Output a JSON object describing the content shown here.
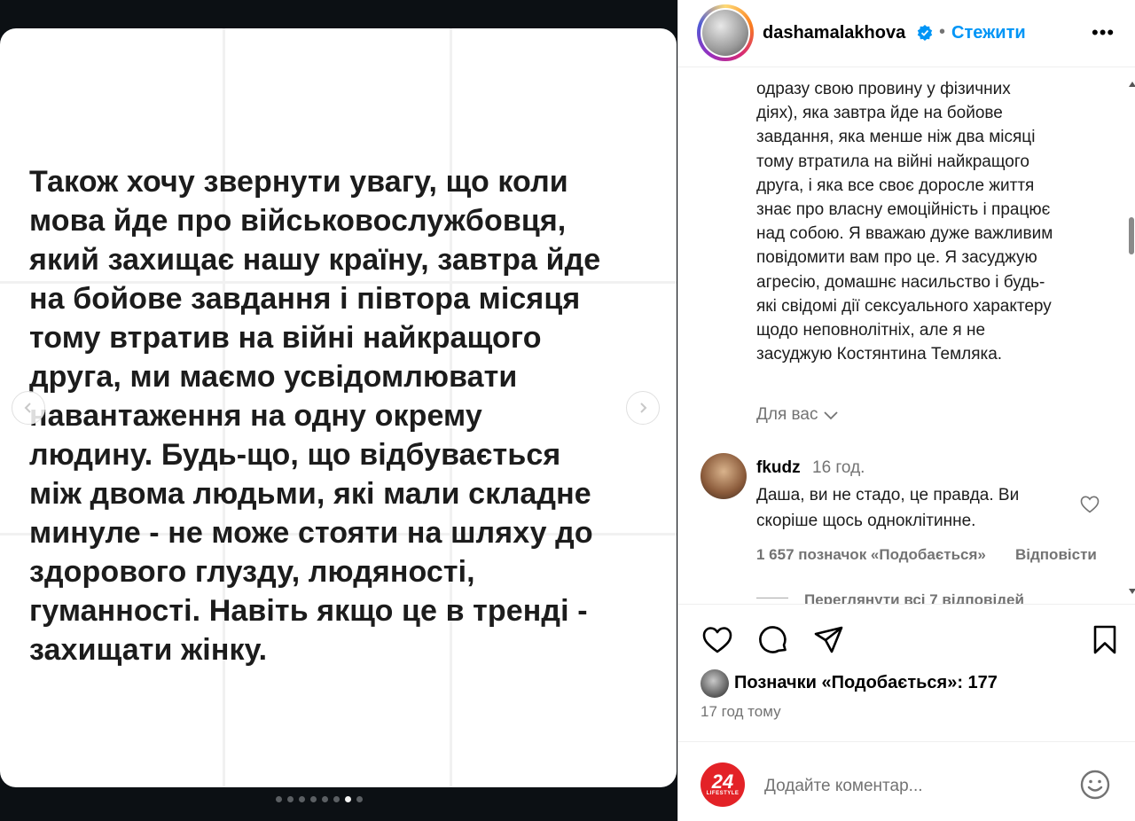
{
  "post": {
    "slide_lines": [
      "Також хочу звернути увагу, що коли",
      "мова йде про військовослужбовця,",
      "який захищає нашу країну, завтра йде",
      "на бойове завдання і півтора місяця",
      "тому втратив на війні найкращого",
      "друга, ми маємо усвідомлювати",
      "навантаження на одну окрему",
      "людину. Будь-що, що відбувається",
      "між двома людьми, які мали складне",
      "минуле - не може стояти на шляху до",
      "здорового глузду, людяності,",
      "гуманності. Навіть якщо це в тренді -",
      "захищати жінку."
    ],
    "carousel_total": 8,
    "carousel_active_index": 6
  },
  "header": {
    "username": "dashamalakhova",
    "separator": "•",
    "follow_label": "Стежити",
    "more_label": "•••"
  },
  "caption": {
    "lines": [
      "одразу свою провину у фізичних",
      "діях), яка завтра йде на бойове",
      "завдання, яка менше ніж два місяці",
      "тому втратила на війні найкращого",
      "друга, і яка все своє доросле життя",
      "знає про власну емоційність і працює",
      "над собою. Я вважаю дуже важливим",
      "повідомити вам про це. Я засуджую",
      "агресію, домашнє насильство і будь-",
      "які свідомі дії сексуального характеру",
      "щодо неповнолітніх, але я не",
      "засуджую Костянтина Темляка."
    ]
  },
  "for_you_label": "Для вас",
  "comment": {
    "username": "fkudz",
    "time": "16 год.",
    "text_lines": [
      "Даша, ви не стадо, це правда. Ви",
      "скоріше щось одноклітинне."
    ],
    "likes_label": "1 657 позначок «Подобається»",
    "reply_label": "Відповісти",
    "view_replies_label": "Переглянути всі 7 відповідей"
  },
  "actions": {
    "likes_text": "Позначки «Подобається»: 177",
    "posted_time": "17 год тому"
  },
  "composer": {
    "placeholder": "Додайте коментар...",
    "avatar_number": "24",
    "avatar_brand": "LIFESTYLE"
  },
  "colors": {
    "accent": "#0095f6",
    "muted": "#737373",
    "media_bg": "#0c1014",
    "brand_red": "#e32227"
  },
  "icons": {
    "verified": "verified-badge-icon",
    "like": "heart-outline-icon",
    "comment": "comment-bubble-icon",
    "share": "paper-plane-icon",
    "save": "bookmark-icon",
    "emoji": "smiley-icon",
    "prev": "chevron-left-icon",
    "next": "chevron-right-icon"
  }
}
